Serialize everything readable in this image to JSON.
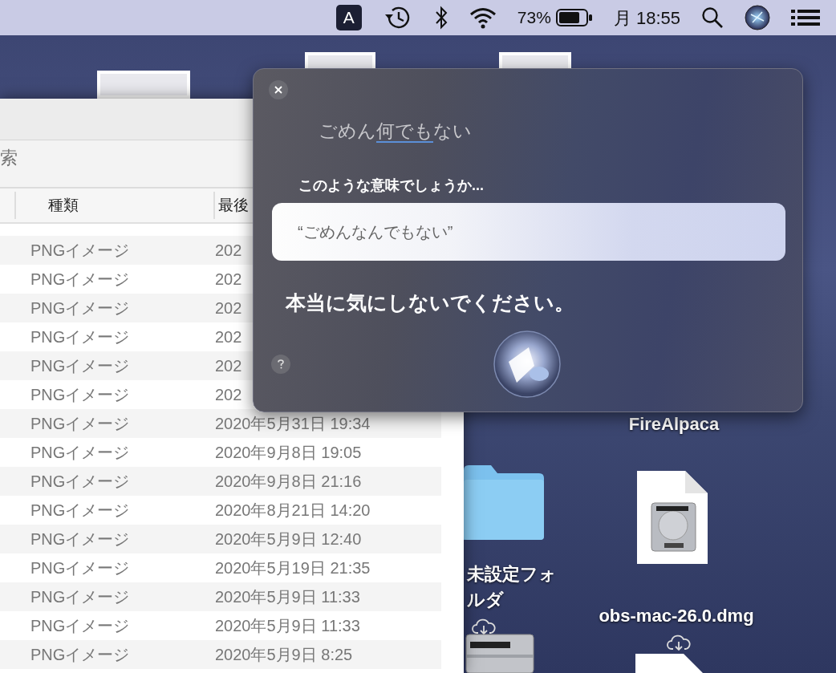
{
  "menu_bar": {
    "input_source": "A",
    "battery_percent": "73%",
    "clock": "月 18:55"
  },
  "finder": {
    "search": {
      "placeholder": "索"
    },
    "columns": [
      "種類",
      "最後"
    ],
    "rows": [
      {
        "type": "PNGイメージ",
        "modified": "202"
      },
      {
        "type": "PNGイメージ",
        "modified": "202"
      },
      {
        "type": "PNGイメージ",
        "modified": "202"
      },
      {
        "type": "PNGイメージ",
        "modified": "202"
      },
      {
        "type": "PNGイメージ",
        "modified": "202"
      },
      {
        "type": "PNGイメージ",
        "modified": "202"
      },
      {
        "type": "PNGイメージ",
        "modified": "2020年5月31日 19:34"
      },
      {
        "type": "PNGイメージ",
        "modified": "2020年9月8日 19:05"
      },
      {
        "type": "PNGイメージ",
        "modified": "2020年9月8日 21:16"
      },
      {
        "type": "PNGイメージ",
        "modified": "2020年8月21日 14:20"
      },
      {
        "type": "PNGイメージ",
        "modified": "2020年5月9日 12:40"
      },
      {
        "type": "PNGイメージ",
        "modified": "2020年5月19日 21:35"
      },
      {
        "type": "PNGイメージ",
        "modified": "2020年5月9日 11:33"
      },
      {
        "type": "PNGイメージ",
        "modified": "2020年5月9日 11:33"
      },
      {
        "type": "PNGイメージ",
        "modified": "2020年5月9日 8:25"
      }
    ]
  },
  "desktop": {
    "items": [
      {
        "kind": "thumbnail"
      },
      {
        "kind": "thumbnail"
      },
      {
        "kind": "thumbnail"
      },
      {
        "kind": "label",
        "label": "FireAlpaca",
        "cloud": false
      },
      {
        "kind": "folder",
        "label": "未設定フォルダ",
        "cloud": true
      },
      {
        "kind": "dmg",
        "label": "obs-mac-26.0.dmg",
        "cloud": true
      },
      {
        "kind": "disk"
      },
      {
        "kind": "file"
      }
    ]
  },
  "siri": {
    "query": [
      {
        "text": "ごめん",
        "underlined": false
      },
      {
        "text": "何でも",
        "underlined": true
      },
      {
        "text": "ない",
        "underlined": false
      }
    ],
    "suggestion_prompt": "このような意味でしょうか...",
    "suggestion": "“ごめんなんでもない”",
    "response": "本当に気にしないでください。"
  }
}
